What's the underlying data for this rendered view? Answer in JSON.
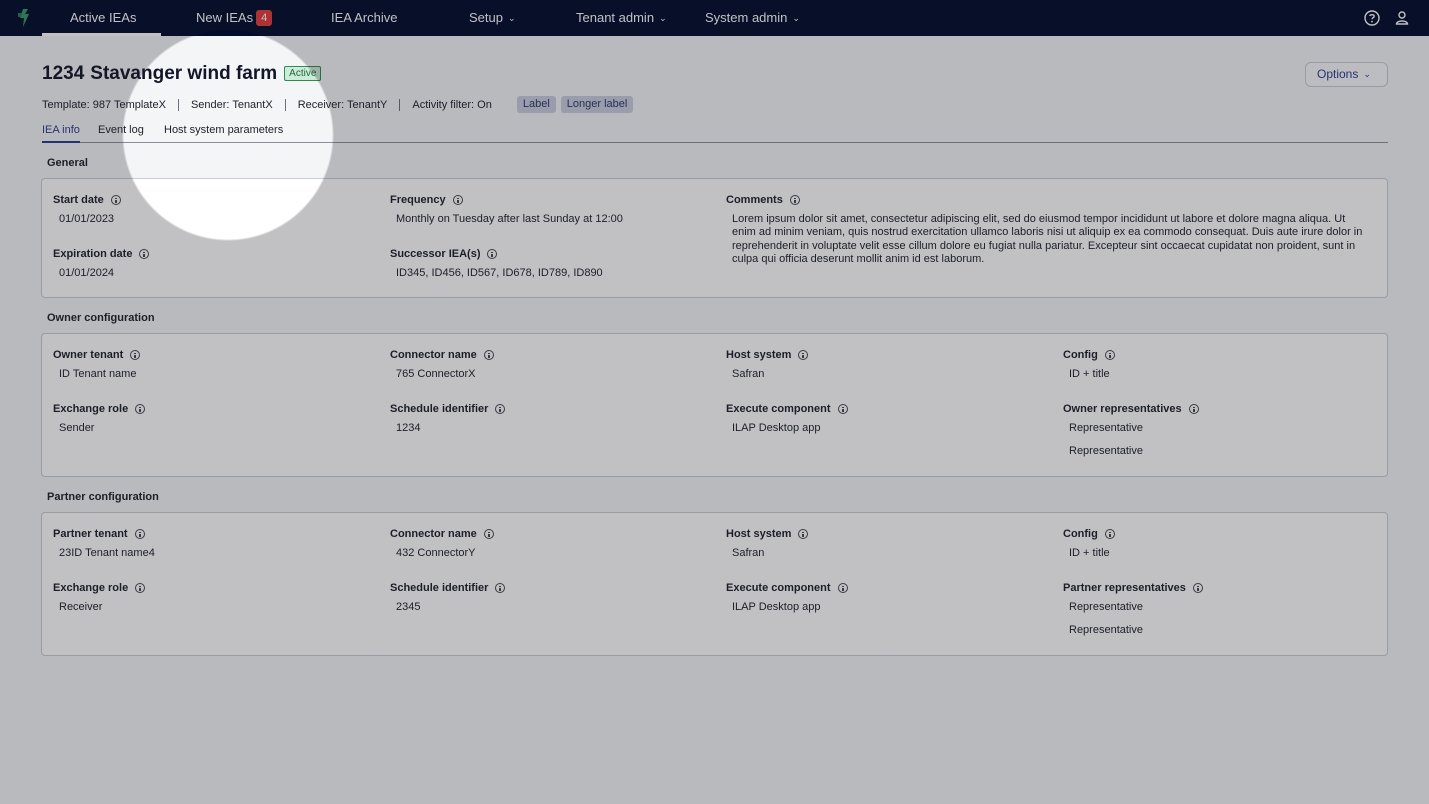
{
  "nav": {
    "items": [
      {
        "label": "Active IEAs"
      },
      {
        "label": "New IEAs",
        "badge": "4"
      },
      {
        "label": "IEA Archive"
      },
      {
        "label": "Setup"
      },
      {
        "label": "Tenant admin"
      },
      {
        "label": "System admin"
      }
    ],
    "help_icon": "help-circle-icon",
    "user_icon": "user-icon"
  },
  "header": {
    "id": "1234",
    "name": "Stavanger wind farm",
    "status": "Active",
    "options_label": "Options",
    "meta": {
      "template": "Template: 987 TemplateX",
      "sender": "Sender: TenantX",
      "receiver": "Receiver: TenantY",
      "activity_filter": "Activity filter: On"
    },
    "labels": [
      "Label",
      "Longer label"
    ]
  },
  "tabs": [
    "IEA info",
    "Event log",
    "Host system parameters"
  ],
  "general": {
    "title": "General",
    "start_date": {
      "label": "Start date",
      "value": "01/01/2023"
    },
    "expiration_date": {
      "label": "Expiration date",
      "value": "01/01/2024"
    },
    "frequency": {
      "label": "Frequency",
      "value": "Monthly on Tuesday after last Sunday at 12:00"
    },
    "successor": {
      "label": "Successor IEA(s)",
      "value": "ID345, ID456, ID567, ID678, ID789, ID890"
    },
    "comments": {
      "label": "Comments",
      "value": "Lorem ipsum dolor sit amet, consectetur adipiscing elit, sed do eiusmod tempor incididunt ut labore et dolore magna aliqua. Ut enim ad minim veniam, quis nostrud exercitation ullamco laboris nisi ut aliquip ex ea commodo consequat. Duis aute irure dolor in reprehenderit in voluptate velit esse cillum dolore eu fugiat nulla pariatur. Excepteur sint occaecat cupidatat non proident, sunt in culpa qui officia deserunt mollit anim id est laborum."
    }
  },
  "owner": {
    "title": "Owner configuration",
    "tenant": {
      "label": "Owner tenant",
      "value": "ID Tenant name"
    },
    "exchange_role": {
      "label": "Exchange role",
      "value": "Sender"
    },
    "connector": {
      "label": "Connector name",
      "value": "765 ConnectorX"
    },
    "schedule": {
      "label": "Schedule identifier",
      "value": "1234"
    },
    "host_system": {
      "label": "Host system",
      "value": "Safran"
    },
    "execute": {
      "label": "Execute component",
      "value": "ILAP Desktop app"
    },
    "config": {
      "label": "Config",
      "value": "ID + title"
    },
    "representatives": {
      "label": "Owner representatives",
      "values": [
        "Representative",
        "Representative"
      ]
    }
  },
  "partner": {
    "title": "Partner configuration",
    "tenant": {
      "label": "Partner tenant",
      "value": "23ID Tenant name4"
    },
    "exchange_role": {
      "label": "Exchange role",
      "value": "Receiver"
    },
    "connector": {
      "label": "Connector name",
      "value": "432 ConnectorY"
    },
    "schedule": {
      "label": "Schedule identifier",
      "value": "2345"
    },
    "host_system": {
      "label": "Host system",
      "value": "Safran"
    },
    "execute": {
      "label": "Execute component",
      "value": "ILAP Desktop app"
    },
    "config": {
      "label": "Config",
      "value": "ID + title"
    },
    "representatives": {
      "label": "Partner representatives",
      "values": [
        "Representative",
        "Representative"
      ]
    }
  }
}
